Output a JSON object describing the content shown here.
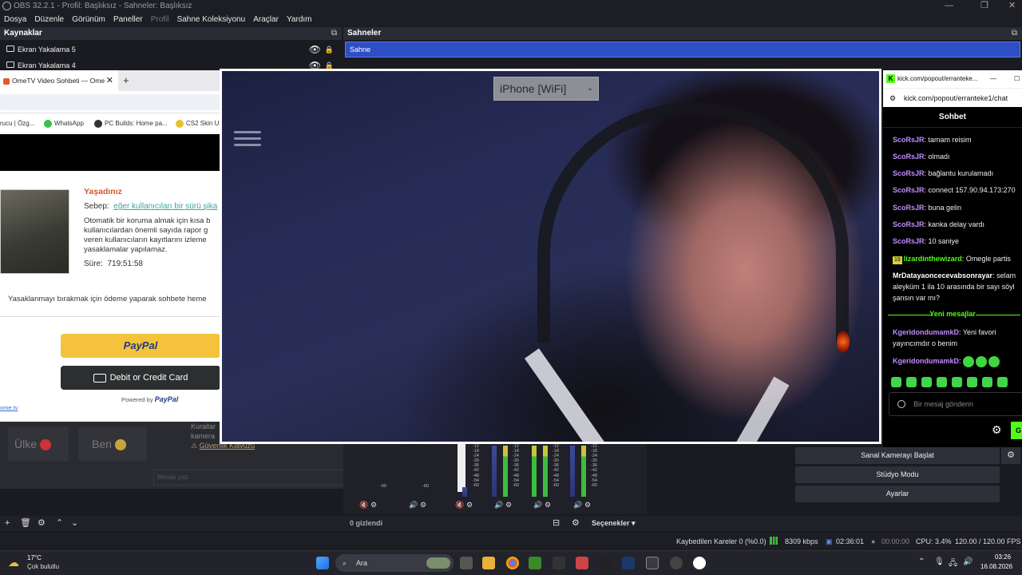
{
  "window": {
    "title": "OBS 32.2.1 - Profil: Başlıksız - Sahneler: Başlıksız"
  },
  "menu": [
    "Dosya",
    "Düzenle",
    "Görünüm",
    "Paneller",
    "Profil",
    "Sahne Koleksiyonu",
    "Araçlar",
    "Yardım"
  ],
  "sources": {
    "header": "Kaynaklar",
    "items": [
      "Ekran Yakalama 5",
      "Ekran Yakalama 4"
    ]
  },
  "scenes": {
    "header": "Sahneler",
    "items": [
      "Sahne"
    ]
  },
  "browser": {
    "tab_title": "OmeTV Video Sohbeti — Ome",
    "bookmarks": [
      "rucu | Özg...",
      "WhatsApp",
      "PC Builds: Home pa...",
      "CS2 Skin U"
    ],
    "ban_title": "Yaşadınız",
    "reason_label": "Sebep:",
    "reason_link": "eğer kullanıcıları bir sürü şika",
    "ban_text": "Otomatik bir koruma almak için kısa b kullanıcılardan önemli sayıda rapor g veren kullanıcıların kayıtlarını izleme yasaklamalar yapılamaz.",
    "duration_label": "Süre:",
    "duration_value": "719:51:58",
    "pay_text": "Yasaklanmayı bırakmak için ödeme yaparak sohbete heme",
    "paypal": "PayPal",
    "card": "Debit or Credit Card",
    "powered": "Powered by",
    "powered_brand": "PayPal",
    "site": "ome.tv"
  },
  "preview": {
    "device_label": "iPhone [WiFi]"
  },
  "underlay": {
    "country": "Ülke",
    "me": "Ben",
    "rules": "Kurallar",
    "camera": "kamera",
    "guide": "Güvenlik Klavuzu",
    "type_hint": "Mesajı yaz"
  },
  "kick": {
    "window_title": "kick.com/popout/erranteke...",
    "url": "kick.com/popout/erranteke1/chat",
    "header": "Sohbet",
    "messages": [
      {
        "user": "ScoRsJR",
        "text": ": tamam reisim"
      },
      {
        "user": "ScoRsJR",
        "text": ": olmadı"
      },
      {
        "user": "ScoRsJR",
        "text": ": bağlantu kurulamadı"
      },
      {
        "user": "ScoRsJR",
        "text": ": connect 157.90.94.173:270"
      },
      {
        "user": "ScoRsJR",
        "text": ": buna gelin"
      },
      {
        "user": "ScoRsJR",
        "text": ": kanka delay vardı"
      },
      {
        "user": "ScoRsJR",
        "text": ": 10 saniye"
      }
    ],
    "badge_msg": {
      "badge": "19",
      "user": "lizardinthewizard",
      "text": ": Omegle partis"
    },
    "long_msg": {
      "user": "MrDatayaoncecevabsonrayar",
      "text": ": selam aleyküm 1 ila 10 arasında bir sayı söyl şansın var mı?"
    },
    "new_messages": "Yeni mesajlar",
    "after": [
      {
        "user": "KgeridondumamkD",
        "text": ": Yeni favori yayıncımdır o benim"
      },
      {
        "user": "KgeridondumamkD",
        "text": ":"
      }
    ],
    "input_placeholder": "Bir mesaj gönderin",
    "send": "G"
  },
  "mixer_scale": [
    "-12",
    "-18",
    "-24",
    "-30",
    "-36",
    "-42",
    "-48",
    "-54",
    "-60"
  ],
  "mixer_scale_left": [
    "-48",
    "-54",
    "-60"
  ],
  "controls": {
    "virtual_cam": "Sanal Kamerayı Başlat",
    "studio": "Stüdyo Modu",
    "settings": "Ayarlar"
  },
  "bottom": {
    "hidden": "0 gizlendi",
    "options": "Seçenekler"
  },
  "status": {
    "dropped": "Kaybedilen Kareler 0 (%0.0)",
    "bitrate": "8309 kbps",
    "stream_time": "02:36:01",
    "rec_time": "00:00:00",
    "cpu": "CPU: 3.4%",
    "fps": "120.00 / 120.00 FPS"
  },
  "taskbar": {
    "weather_temp": "17°C",
    "weather_desc": "Çok bulutlu",
    "search": "Ara",
    "time": "03:26",
    "date": "16.08.2026"
  },
  "colors": {
    "accent": "#2e4ec4",
    "kick_green": "#53fc18",
    "paypal_yellow": "#f5c33b"
  }
}
